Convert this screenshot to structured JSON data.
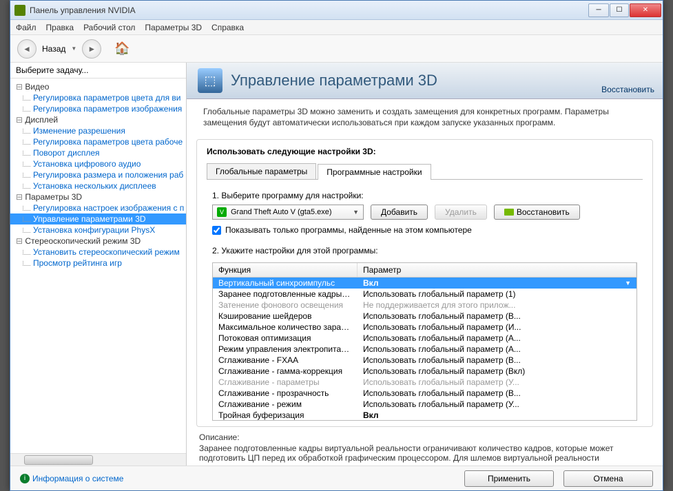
{
  "window": {
    "title": "Панель управления NVIDIA"
  },
  "menu": {
    "file": "Файл",
    "edit": "Правка",
    "desktop": "Рабочий стол",
    "params3d": "Параметры 3D",
    "help": "Справка"
  },
  "toolbar": {
    "back": "Назад"
  },
  "sidebar": {
    "title": "Выберите задачу...",
    "groups": [
      {
        "label": "Видео",
        "items": [
          "Регулировка параметров цвета для ви",
          "Регулировка параметров изображения"
        ]
      },
      {
        "label": "Дисплей",
        "items": [
          "Изменение разрешения",
          "Регулировка параметров цвета рабоче",
          "Поворот дисплея",
          "Установка цифрового аудио",
          "Регулировка размера и положения раб",
          "Установка нескольких дисплеев"
        ]
      },
      {
        "label": "Параметры 3D",
        "items": [
          "Регулировка настроек изображения с п",
          "Управление параметрами 3D",
          "Установка конфигурации PhysX"
        ]
      },
      {
        "label": "Стереоскопический режим 3D",
        "items": [
          "Установить стереоскопический режим",
          "Просмотр рейтинга игр"
        ]
      }
    ],
    "selected": "Управление параметрами 3D"
  },
  "main": {
    "title": "Управление параметрами 3D",
    "restore": "Восстановить",
    "description": "Глобальные параметры 3D можно заменить и создать замещения для конкретных программ. Параметры замещения будут автоматически использоваться при каждом запуске указанных программ.",
    "settings_head": "Использовать следующие настройки 3D:",
    "tabs": {
      "global": "Глобальные параметры",
      "program": "Программные настройки"
    },
    "step1": "1. Выберите программу для настройки:",
    "program_selected": "Grand Theft Auto V (gta5.exe)",
    "add_btn": "Добавить",
    "remove_btn": "Удалить",
    "restore_btn": "Восстановить",
    "show_only_found": "Показывать только программы, найденные на этом компьютере",
    "step2": "2. Укажите настройки для этой программы:",
    "col_func": "Функция",
    "col_param": "Параметр",
    "rows": [
      {
        "f": "Вертикальный синхроимпульс",
        "p": "Вкл",
        "sel": true
      },
      {
        "f": "Заранее подготовленные кадры вирту...",
        "p": "Использовать глобальный параметр (1)"
      },
      {
        "f": "Затенение фонового освещения",
        "p": "Не поддерживается для этого прилож...",
        "dis": true
      },
      {
        "f": "Кэширование шейдеров",
        "p": "Использовать глобальный параметр (В..."
      },
      {
        "f": "Максимальное количество заранее под...",
        "p": "Использовать глобальный параметр (И..."
      },
      {
        "f": "Потоковая оптимизация",
        "p": "Использовать глобальный параметр (А..."
      },
      {
        "f": "Режим управления электропитанием",
        "p": "Использовать глобальный параметр (А..."
      },
      {
        "f": "Сглаживание - FXAA",
        "p": "Использовать глобальный параметр (В..."
      },
      {
        "f": "Сглаживание - гамма-коррекция",
        "p": "Использовать глобальный параметр (Вкл)"
      },
      {
        "f": "Сглаживание - параметры",
        "p": "Использовать глобальный параметр (У...",
        "dis": true
      },
      {
        "f": "Сглаживание - прозрачность",
        "p": "Использовать глобальный параметр (В..."
      },
      {
        "f": "Сглаживание - режим",
        "p": "Использовать глобальный параметр (У..."
      },
      {
        "f": "Тройная буферизация",
        "p": "Вкл",
        "bold": true
      }
    ],
    "desc_title": "Описание:",
    "desc_body": "Заранее подготовленные кадры виртуальной реальности ограничивают количество кадров, которые может подготовить ЦП перед их обработкой графическим процессором. Для шлемов виртуальной реальности"
  },
  "footer": {
    "sysinfo": "Информация о системе",
    "apply": "Применить",
    "cancel": "Отмена"
  }
}
